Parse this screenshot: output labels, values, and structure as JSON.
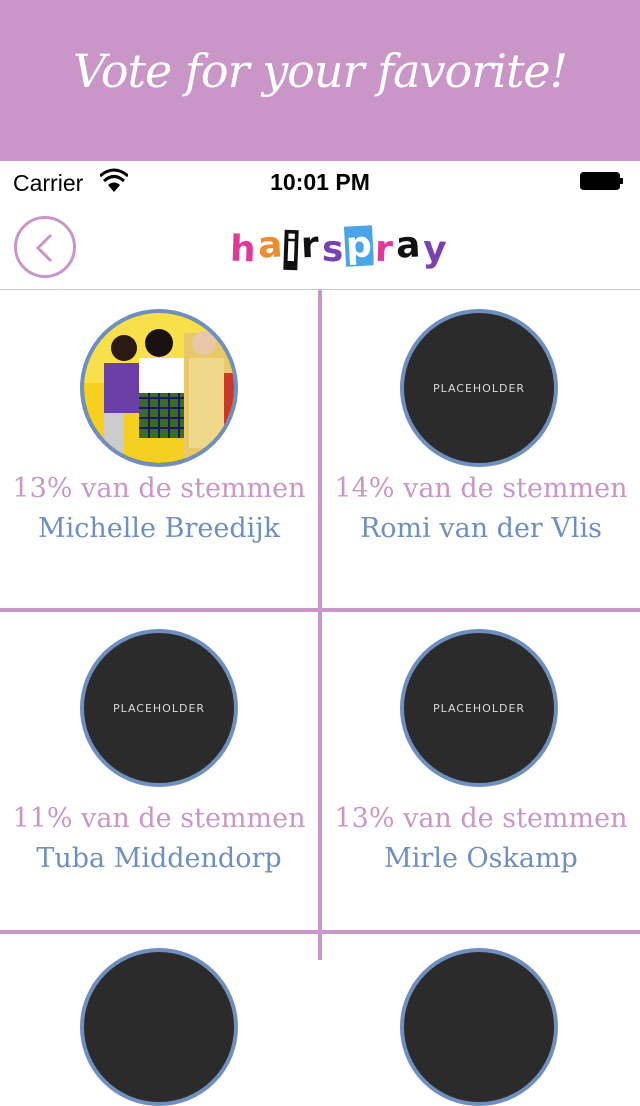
{
  "banner": {
    "title": "Vote for your favorite!"
  },
  "status_bar": {
    "carrier": "Carrier",
    "time": "10:01 PM"
  },
  "nav": {
    "logo_letters": [
      {
        "ch": "h",
        "bg": "#ffffff",
        "fg": "#e0399a"
      },
      {
        "ch": "a",
        "bg": "#ffffff",
        "fg": "#f08a2a"
      },
      {
        "ch": "i",
        "bg": "#111111",
        "fg": "#ffffff"
      },
      {
        "ch": "r",
        "bg": "#ffffff",
        "fg": "#111111"
      },
      {
        "ch": "s",
        "bg": "#ffffff",
        "fg": "#7a3fb0"
      },
      {
        "ch": "p",
        "bg": "#4aa4e8",
        "fg": "#ffffff"
      },
      {
        "ch": "r",
        "bg": "#ffffff",
        "fg": "#e0399a"
      },
      {
        "ch": "a",
        "bg": "#ffffff",
        "fg": "#111111"
      },
      {
        "ch": "y",
        "bg": "#ffffff",
        "fg": "#7a3fb0"
      }
    ]
  },
  "contestants": [
    {
      "percent_text": "13% van de stemmen",
      "name": "Michelle Breedijk",
      "has_photo": true
    },
    {
      "percent_text": "14% van de stemmen",
      "name": "Romi van der Vlis",
      "has_photo": false,
      "placeholder": "PLACEHOLDER"
    },
    {
      "percent_text": "11% van de stemmen",
      "name": "Tuba Middendorp",
      "has_photo": false,
      "placeholder": "PLACEHOLDER"
    },
    {
      "percent_text": "13% van de stemmen",
      "name": "Mirle Oskamp",
      "has_photo": false,
      "placeholder": "PLACEHOLDER"
    }
  ],
  "colors": {
    "accent_pink": "#c996c7",
    "accent_blue": "#6e8fbf"
  }
}
